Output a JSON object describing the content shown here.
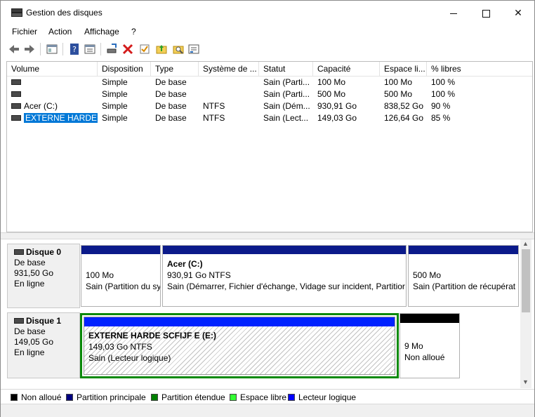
{
  "window": {
    "title": "Gestion des disques"
  },
  "menu": {
    "items": [
      "Fichier",
      "Action",
      "Affichage",
      "?"
    ]
  },
  "toolbar": {
    "buttons": [
      "back-icon",
      "forward-icon",
      "console-tree-icon",
      "help-icon",
      "properties-icon",
      "connect-icon",
      "delete-icon",
      "check-icon",
      "folder-up-icon",
      "search-folder-icon",
      "settings-list-icon"
    ]
  },
  "list": {
    "columns": [
      "Volume",
      "Disposition",
      "Type",
      "Système de ...",
      "Statut",
      "Capacité",
      "Espace li...",
      "% libres"
    ],
    "rows": [
      {
        "volume": "",
        "disposition": "Simple",
        "type": "De base",
        "fs": "",
        "status": "Sain (Parti...",
        "capacity": "100 Mo",
        "free": "100 Mo",
        "pct": "100 %"
      },
      {
        "volume": "",
        "disposition": "Simple",
        "type": "De base",
        "fs": "",
        "status": "Sain (Parti...",
        "capacity": "500 Mo",
        "free": "500 Mo",
        "pct": "100 %"
      },
      {
        "volume": "Acer (C:)",
        "disposition": "Simple",
        "type": "De base",
        "fs": "NTFS",
        "status": "Sain (Dém...",
        "capacity": "930,91 Go",
        "free": "838,52 Go",
        "pct": "90 %"
      },
      {
        "volume": "EXTERNE HARDE S...",
        "disposition": "Simple",
        "type": "De base",
        "fs": "NTFS",
        "status": "Sain (Lect...",
        "capacity": "149,03 Go",
        "free": "126,64 Go",
        "pct": "85 %"
      }
    ]
  },
  "disks": [
    {
      "name": "Disque 0",
      "type": "De base",
      "size": "931,50 Go",
      "state": "En ligne",
      "partitions": [
        {
          "title": "",
          "line1": "100 Mo",
          "line2": "Sain (Partition du sy"
        },
        {
          "title": "Acer  (C:)",
          "line1": "930,91 Go NTFS",
          "line2": "Sain (Démarrer, Fichier d'échange, Vidage sur incident, Partitior"
        },
        {
          "title": "",
          "line1": "500 Mo",
          "line2": "Sain (Partition de récupérat"
        }
      ]
    },
    {
      "name": "Disque 1",
      "type": "De base",
      "size": "149,05 Go",
      "state": "En ligne",
      "partitions": [
        {
          "title": "EXTERNE HARDE SCFIJF E  (E:)",
          "line1": "149,03 Go NTFS",
          "line2": "Sain (Lecteur logique)"
        },
        {
          "title": "",
          "line1": "9 Mo",
          "line2": "Non alloué"
        }
      ]
    }
  ],
  "legend": [
    {
      "label": "Non alloué",
      "color": "#000000"
    },
    {
      "label": "Partition principale",
      "color": "#000080"
    },
    {
      "label": "Partition étendue",
      "color": "#008000"
    },
    {
      "label": "Espace libre",
      "color": "#33ff33"
    },
    {
      "label": "Lecteur logique",
      "color": "#0000ff"
    }
  ]
}
